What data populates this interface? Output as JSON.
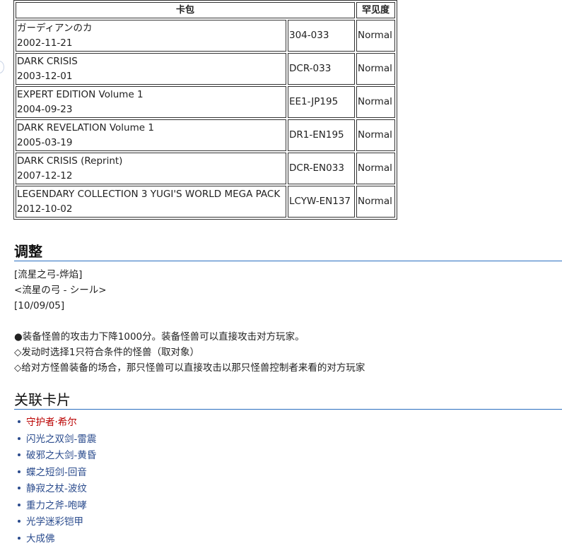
{
  "table": {
    "headers": {
      "pack": "卡包",
      "rarity": "罕见度"
    },
    "rows": [
      {
        "name": "ガーディアンのカ",
        "date": "2002-11-21",
        "code": "304-033",
        "rarity": "Normal"
      },
      {
        "name": "DARK CRISIS",
        "date": "2003-12-01",
        "code": "DCR-033",
        "rarity": "Normal"
      },
      {
        "name": "EXPERT EDITION Volume 1",
        "date": "2004-09-23",
        "code": "EE1-JP195",
        "rarity": "Normal"
      },
      {
        "name": "DARK REVELATION Volume 1",
        "date": "2005-03-19",
        "code": "DR1-EN195",
        "rarity": "Normal"
      },
      {
        "name": "DARK CRISIS (Reprint)",
        "date": "2007-12-12",
        "code": "DCR-EN033",
        "rarity": "Normal"
      },
      {
        "name": "LEGENDARY COLLECTION 3 YUGI'S WORLD MEGA PACK",
        "date": "2012-10-02",
        "code": "LCYW-EN137",
        "rarity": "Normal"
      }
    ]
  },
  "adjust": {
    "heading": "调整",
    "lines": [
      "[流星之弓-烨焰]",
      "<流星の弓 - シール>",
      "[10/09/05]"
    ],
    "effects": [
      "●装备怪兽的攻击力下降1000分。装备怪兽可以直接攻击对方玩家。",
      "◇发动时选择1只符合条件的怪兽（取对象）",
      "◇给对方怪兽装备的场合，那只怪兽可以直接攻击以那只怪兽控制者来看的对方玩家"
    ]
  },
  "related": {
    "heading": "关联卡片",
    "items": [
      {
        "label": "守护者·希尔",
        "missing": true
      },
      {
        "label": "闪光之双剑-雷震",
        "missing": false
      },
      {
        "label": "破邪之大剑-黄昏",
        "missing": false
      },
      {
        "label": "蝶之短剑-回音",
        "missing": false
      },
      {
        "label": "静寂之杖-波纹",
        "missing": false
      },
      {
        "label": "重力之斧-咆哮",
        "missing": false
      },
      {
        "label": "光学迷彩铠甲",
        "missing": false
      },
      {
        "label": "大成佛",
        "missing": false
      }
    ],
    "colors": {
      "link": "#2a4b8d",
      "missing_link": "#ba0000",
      "heading_rule": "#2a6fc0"
    }
  }
}
